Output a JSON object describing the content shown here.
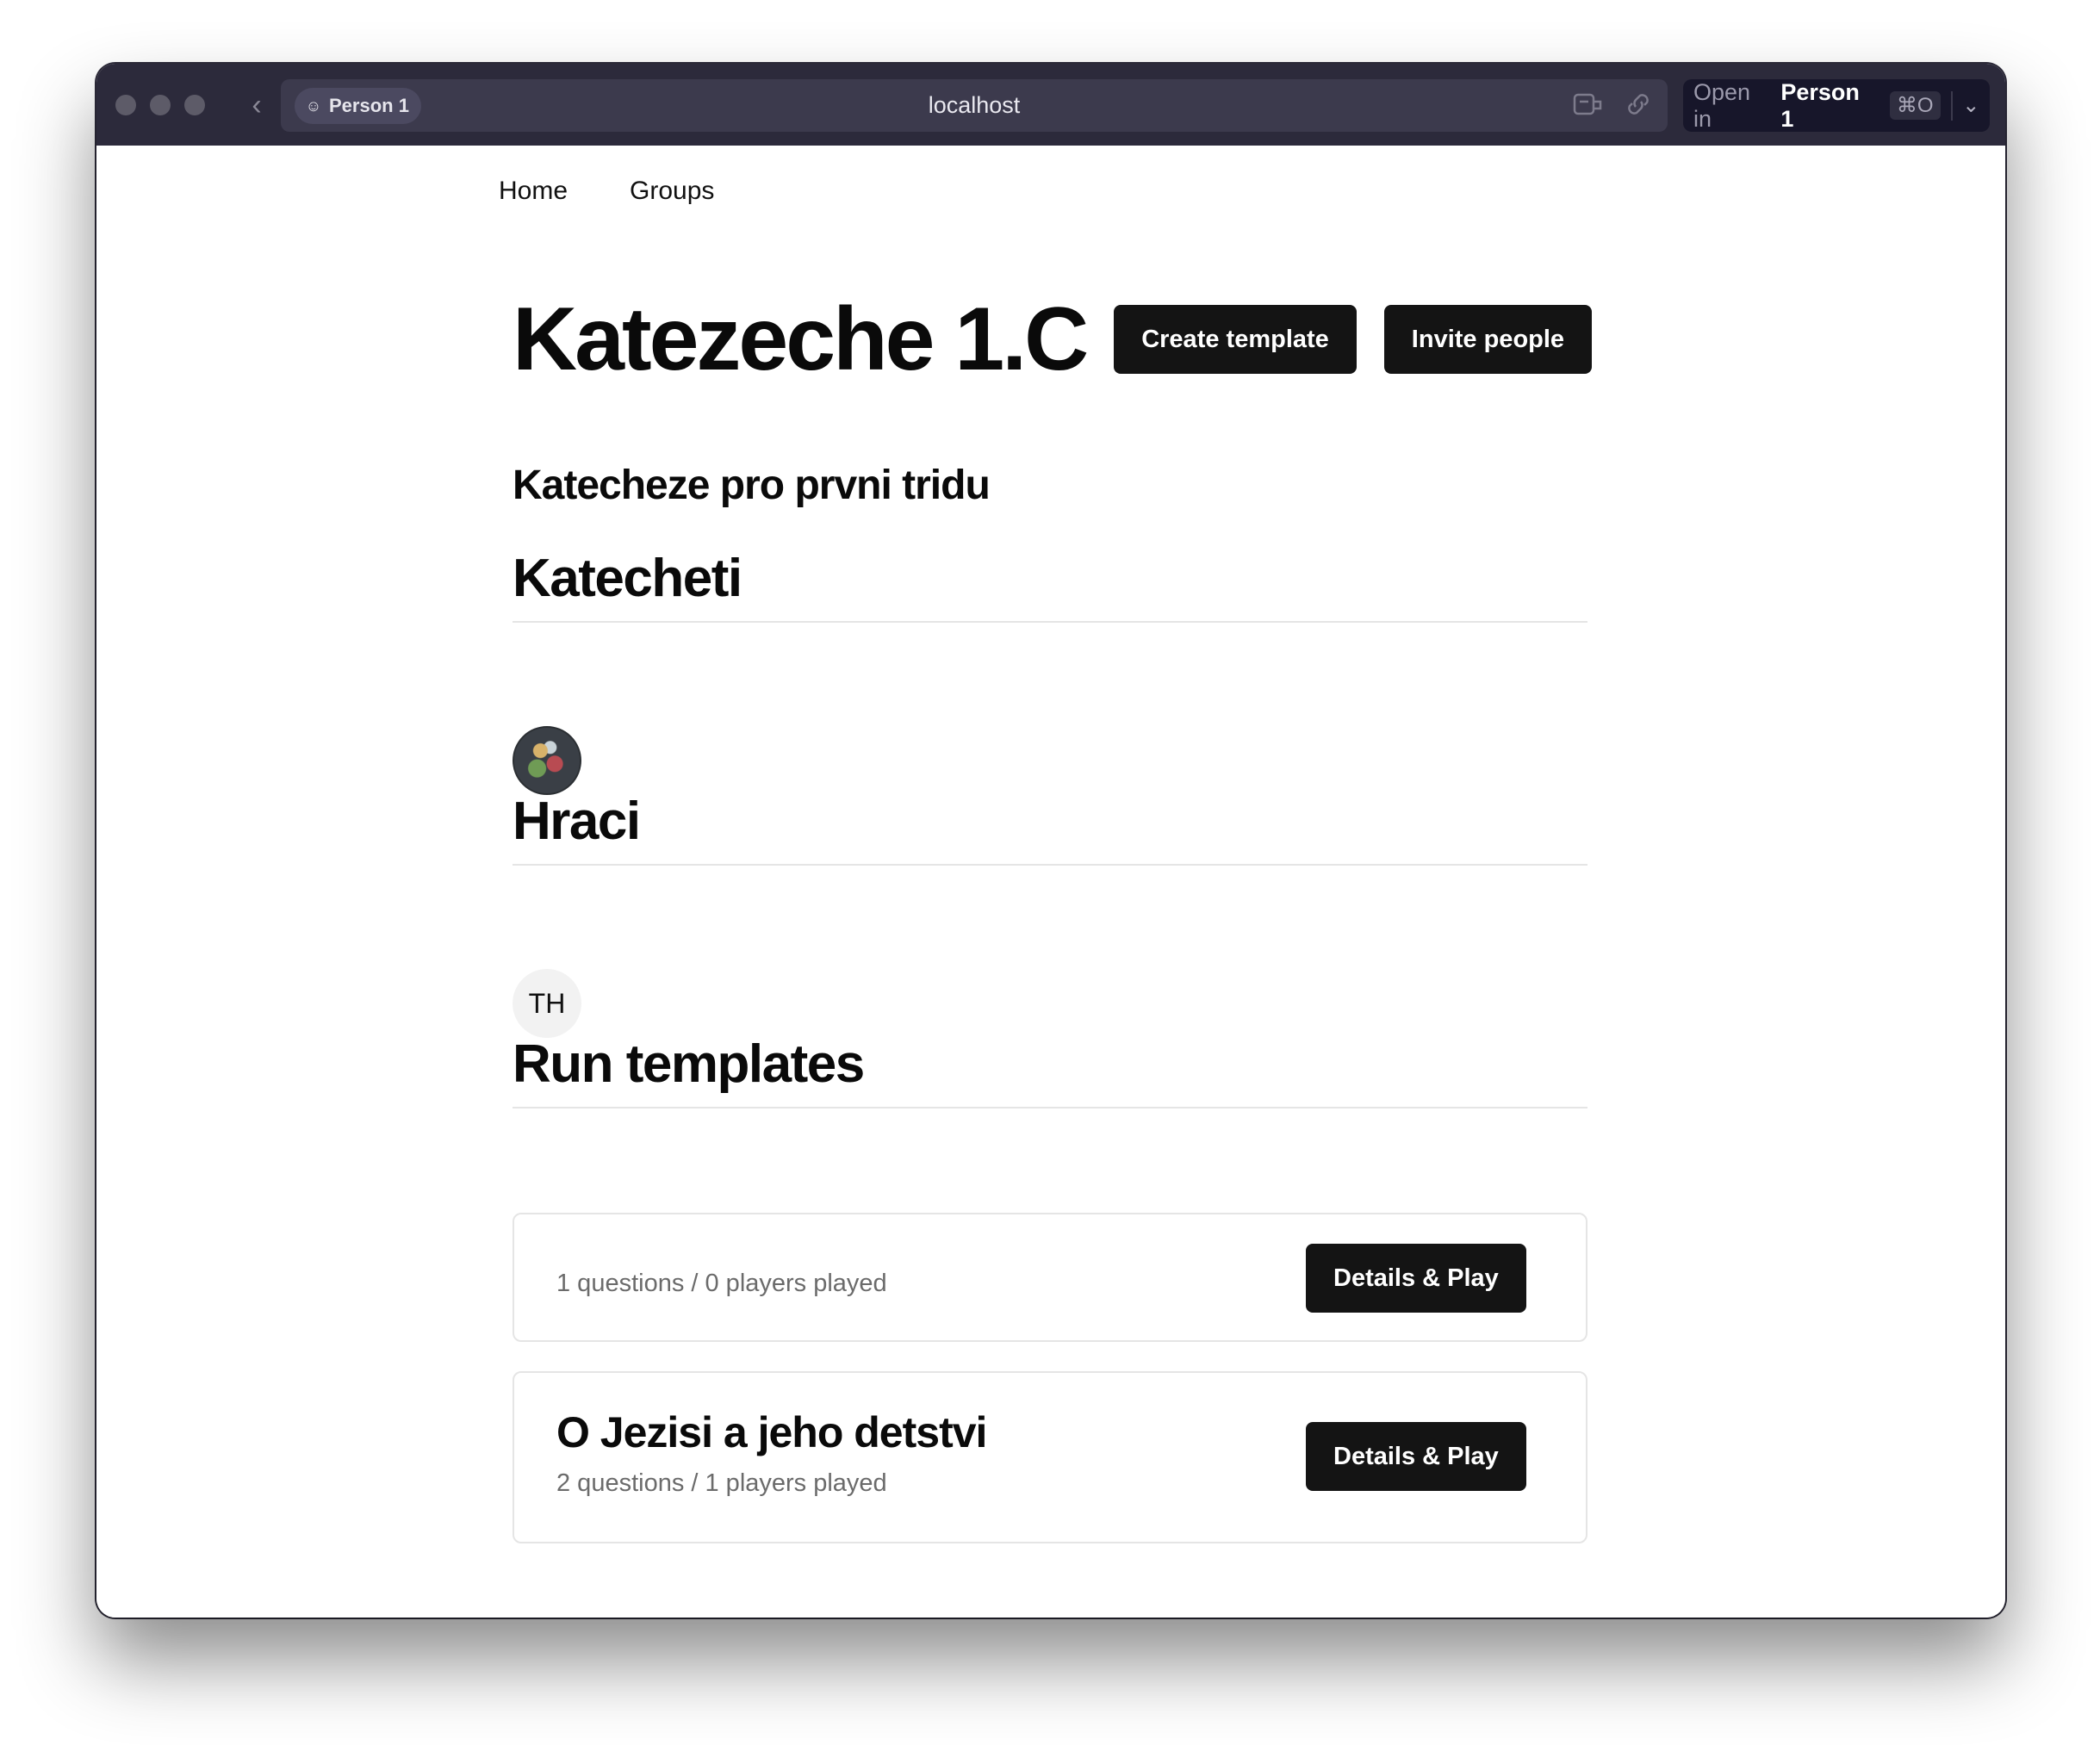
{
  "browser": {
    "profile_chip": "Person 1",
    "url": "localhost",
    "open_in_prefix": "Open in",
    "open_in_profile": "Person 1",
    "open_in_shortcut": "⌘O"
  },
  "nav": {
    "home": "Home",
    "groups": "Groups"
  },
  "group": {
    "title": "Katezeche 1.C",
    "create_template_label": "Create template",
    "invite_people_label": "Invite people",
    "description": "Katecheze pro prvni tridu"
  },
  "sections": {
    "catechists": "Katecheti",
    "players": "Hraci",
    "run_templates": "Run templates"
  },
  "players": {
    "initials": "TH"
  },
  "templates": [
    {
      "title": "",
      "meta": "1 questions / 0 players played",
      "button": "Details & Play"
    },
    {
      "title": "O Jezisi a jeho detstvi",
      "meta": "2 questions / 1 players played",
      "button": "Details & Play"
    }
  ]
}
